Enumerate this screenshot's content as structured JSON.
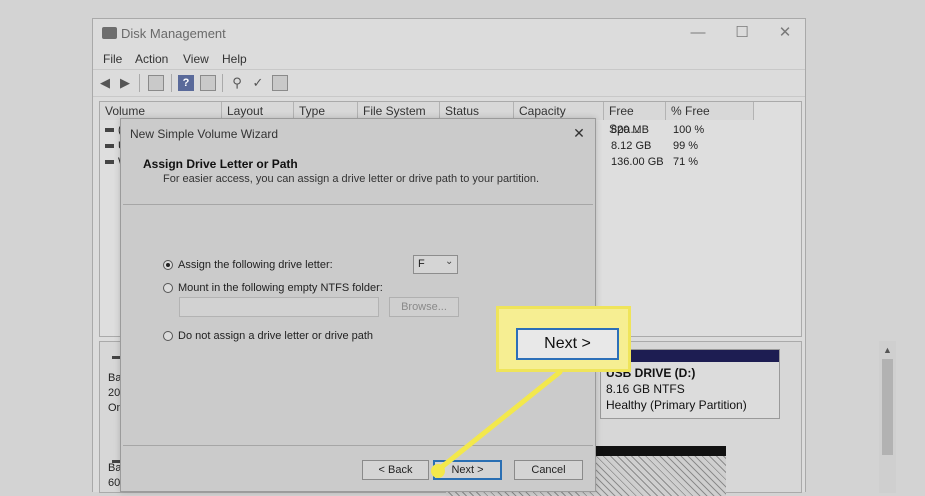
{
  "window": {
    "title": "Disk Management",
    "controls": {
      "minimize": "—",
      "maximize": "☐",
      "close": "✕"
    }
  },
  "menubar": {
    "items": [
      "File",
      "Action",
      "View",
      "Help"
    ]
  },
  "toolbar": {
    "buttons": [
      "back-arrow-icon",
      "forward-arrow-icon",
      "properties-icon",
      "help-icon",
      "view-icon",
      "connect-icon",
      "check-icon",
      "list-icon"
    ]
  },
  "volume_table": {
    "columns": [
      "Volume",
      "Layout",
      "Type",
      "File System",
      "Status",
      "Capacity",
      "Free Spa...",
      "% Free"
    ],
    "rows": [
      {
        "volume": "(",
        "free_space": "820 MB",
        "pct_free": "100 %"
      },
      {
        "volume": "U",
        "free_space": "8.12 GB",
        "pct_free": "99 %"
      },
      {
        "volume": "W",
        "free_space": "136.00 GB",
        "pct_free": "71 %"
      }
    ]
  },
  "disk_pane": {
    "disk1_lines": [
      "Ba",
      "20",
      "On"
    ],
    "disk2_lines": [
      "Ba",
      "60"
    ],
    "usb_volume": {
      "name": "USB DRIVE  (D:)",
      "size_fs": "8.16 GB NTFS",
      "status": "Healthy (Primary Partition)",
      "bar_color": "#1d1d52"
    }
  },
  "wizard": {
    "title": "New Simple Volume Wizard",
    "close": "✕",
    "heading": "Assign Drive Letter or Path",
    "subheading": "For easier access, you can assign a drive letter or drive path to your partition.",
    "options": {
      "assign_letter": {
        "label": "Assign the following drive letter:",
        "selected": true
      },
      "mount_folder": {
        "label": "Mount in the following empty NTFS folder:",
        "selected": false
      },
      "no_letter": {
        "label": "Do not assign a drive letter or drive path",
        "selected": false
      }
    },
    "drive_letter": "F",
    "browse_label": "Browse...",
    "buttons": {
      "back": "< Back",
      "next": "Next >",
      "cancel": "Cancel"
    }
  },
  "callout": {
    "label": "Next >",
    "fill": "#f6ee92",
    "border": "#efe45a",
    "button_border": "#2c6fb8"
  }
}
